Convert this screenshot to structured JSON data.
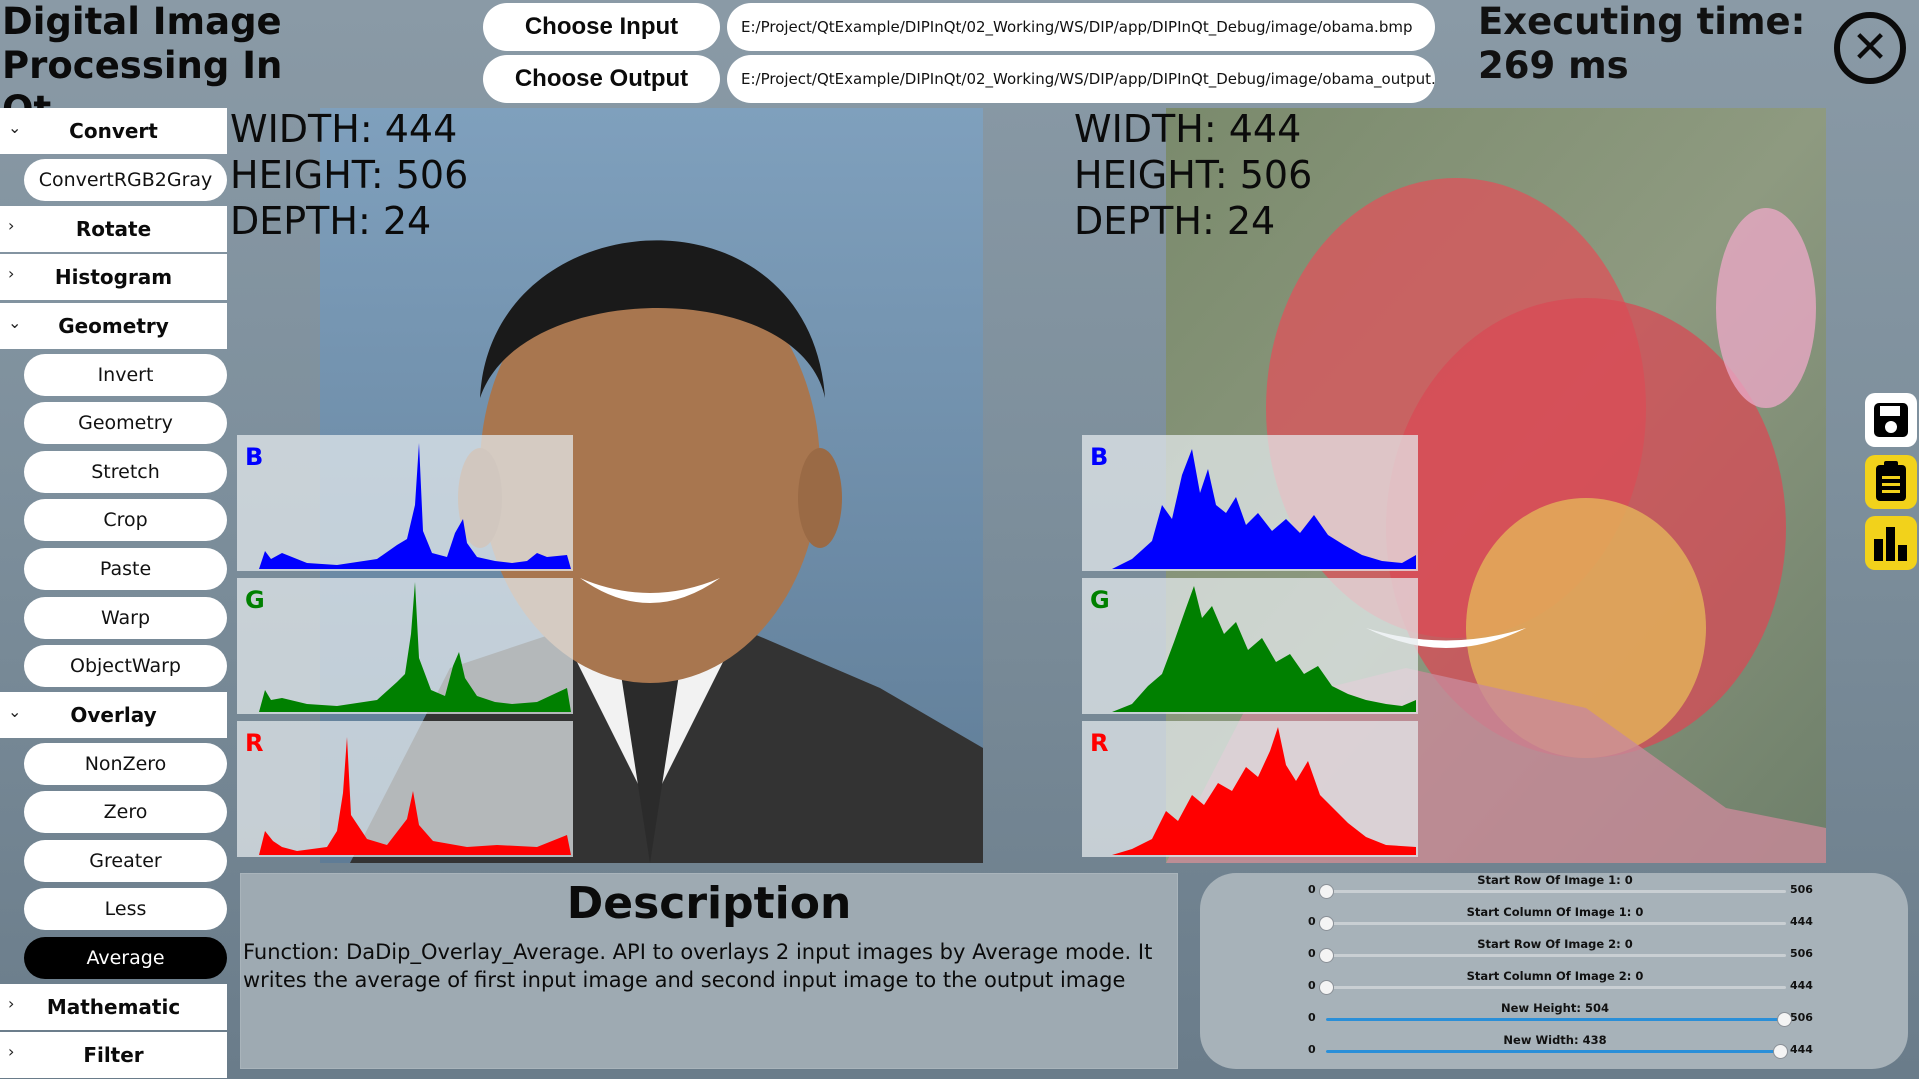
{
  "header": {
    "app_title": "Digital Image Processing In Qt",
    "choose_input_label": "Choose Input",
    "choose_output_label": "Choose Output",
    "input_path": "E:/Project/QtExample/DIPInQt/02_Working/WS/DIP/app/DIPInQt_Debug/image/obama.bmp",
    "output_path": "E:/Project/QtExample/DIPInQt/02_Working/WS/DIP/app/DIPInQt_Debug/image/obama_output.bmp",
    "exec_label": "Executing time:",
    "exec_value": "269 ms",
    "close_icon": "close-icon"
  },
  "sidebar": {
    "convert": {
      "label": "Convert",
      "expanded": true,
      "items": [
        "ConvertRGB2Gray"
      ]
    },
    "rotate": {
      "label": "Rotate",
      "expanded": false
    },
    "histogram": {
      "label": "Histogram",
      "expanded": false
    },
    "geometry": {
      "label": "Geometry",
      "expanded": true,
      "items": [
        "Invert",
        "Geometry",
        "Stretch",
        "Crop",
        "Paste",
        "Warp",
        "ObjectWarp"
      ]
    },
    "overlay": {
      "label": "Overlay",
      "expanded": true,
      "items": [
        "NonZero",
        "Zero",
        "Greater",
        "Less",
        "Average"
      ]
    },
    "mathematic": {
      "label": "Mathematic",
      "expanded": false
    },
    "filter": {
      "label": "Filter",
      "expanded": false
    },
    "selected": "Average"
  },
  "input_image": {
    "width_text": "WIDTH: 444",
    "height_text": "HEIGHT: 506",
    "depth_text": "DEPTH: 24"
  },
  "output_image": {
    "width_text": "WIDTH: 444",
    "height_text": "HEIGHT: 506",
    "depth_text": "DEPTH: 24"
  },
  "histogram_channels": [
    {
      "label": "B",
      "color": "#0000ff"
    },
    {
      "label": "G",
      "color": "#008000"
    },
    {
      "label": "R",
      "color": "#ff0000"
    }
  ],
  "description": {
    "title": "Description",
    "text": "Function: DaDip_Overlay_Average. API to overlays 2 input images by Average mode. It writes the average of first input image and second input image to the output image"
  },
  "sliders": [
    {
      "label": "Start Row Of Image 1: 0",
      "min": "0",
      "max": "506",
      "value": 0,
      "max_value": 506
    },
    {
      "label": "Start Column Of Image 1: 0",
      "min": "0",
      "max": "444",
      "value": 0,
      "max_value": 444
    },
    {
      "label": "Start Row Of Image 2: 0",
      "min": "0",
      "max": "506",
      "value": 0,
      "max_value": 506
    },
    {
      "label": "Start Column Of Image 2: 0",
      "min": "0",
      "max": "444",
      "value": 0,
      "max_value": 444
    },
    {
      "label": "New Height: 504",
      "min": "0",
      "max": "506",
      "value": 504,
      "max_value": 506
    },
    {
      "label": "New Width: 438",
      "min": "0",
      "max": "444",
      "value": 438,
      "max_value": 444
    }
  ],
  "toolbar": {
    "save_icon": "save-icon",
    "clipboard_icon": "clipboard-icon",
    "chart_icon": "bar-chart-icon",
    "accent_color": "#f2d21b"
  },
  "colors": {
    "slider_fill": "#2a8fd8",
    "selected_bg": "#000000"
  }
}
